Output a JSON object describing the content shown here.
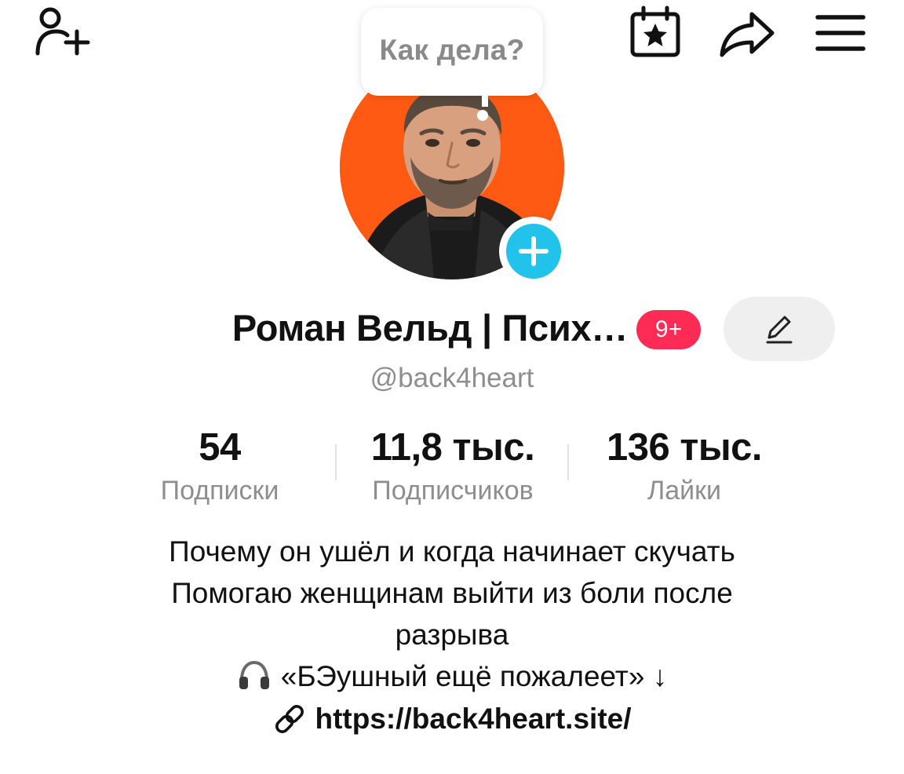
{
  "header": {
    "icons": {
      "add_friend": "add-friend-icon",
      "calendar": "calendar-star-icon",
      "share": "share-arrow-icon",
      "menu": "hamburger-menu-icon"
    }
  },
  "status_bubble": {
    "text": "Как дела?"
  },
  "profile": {
    "display_name": "Роман Вельд | Псих…",
    "badge": "9+",
    "username": "@back4heart",
    "colors": {
      "avatar_bg": "#ff5a14",
      "add_button": "#21c3ea",
      "badge": "#fe2c55"
    }
  },
  "stats": [
    {
      "value": "54",
      "label": "Подписки"
    },
    {
      "value": "11,8 тыс.",
      "label": "Подписчиков"
    },
    {
      "value": "136 тыс.",
      "label": "Лайки"
    }
  ],
  "bio": {
    "line1": "Почему он ушёл и когда начинает скучать",
    "line2": "Помогаю женщинам выйти из боли после",
    "line3": "разрыва",
    "line4": "«БЭушный ещё пожалеет» ↓"
  },
  "link": {
    "url": "https://back4heart.site/"
  }
}
